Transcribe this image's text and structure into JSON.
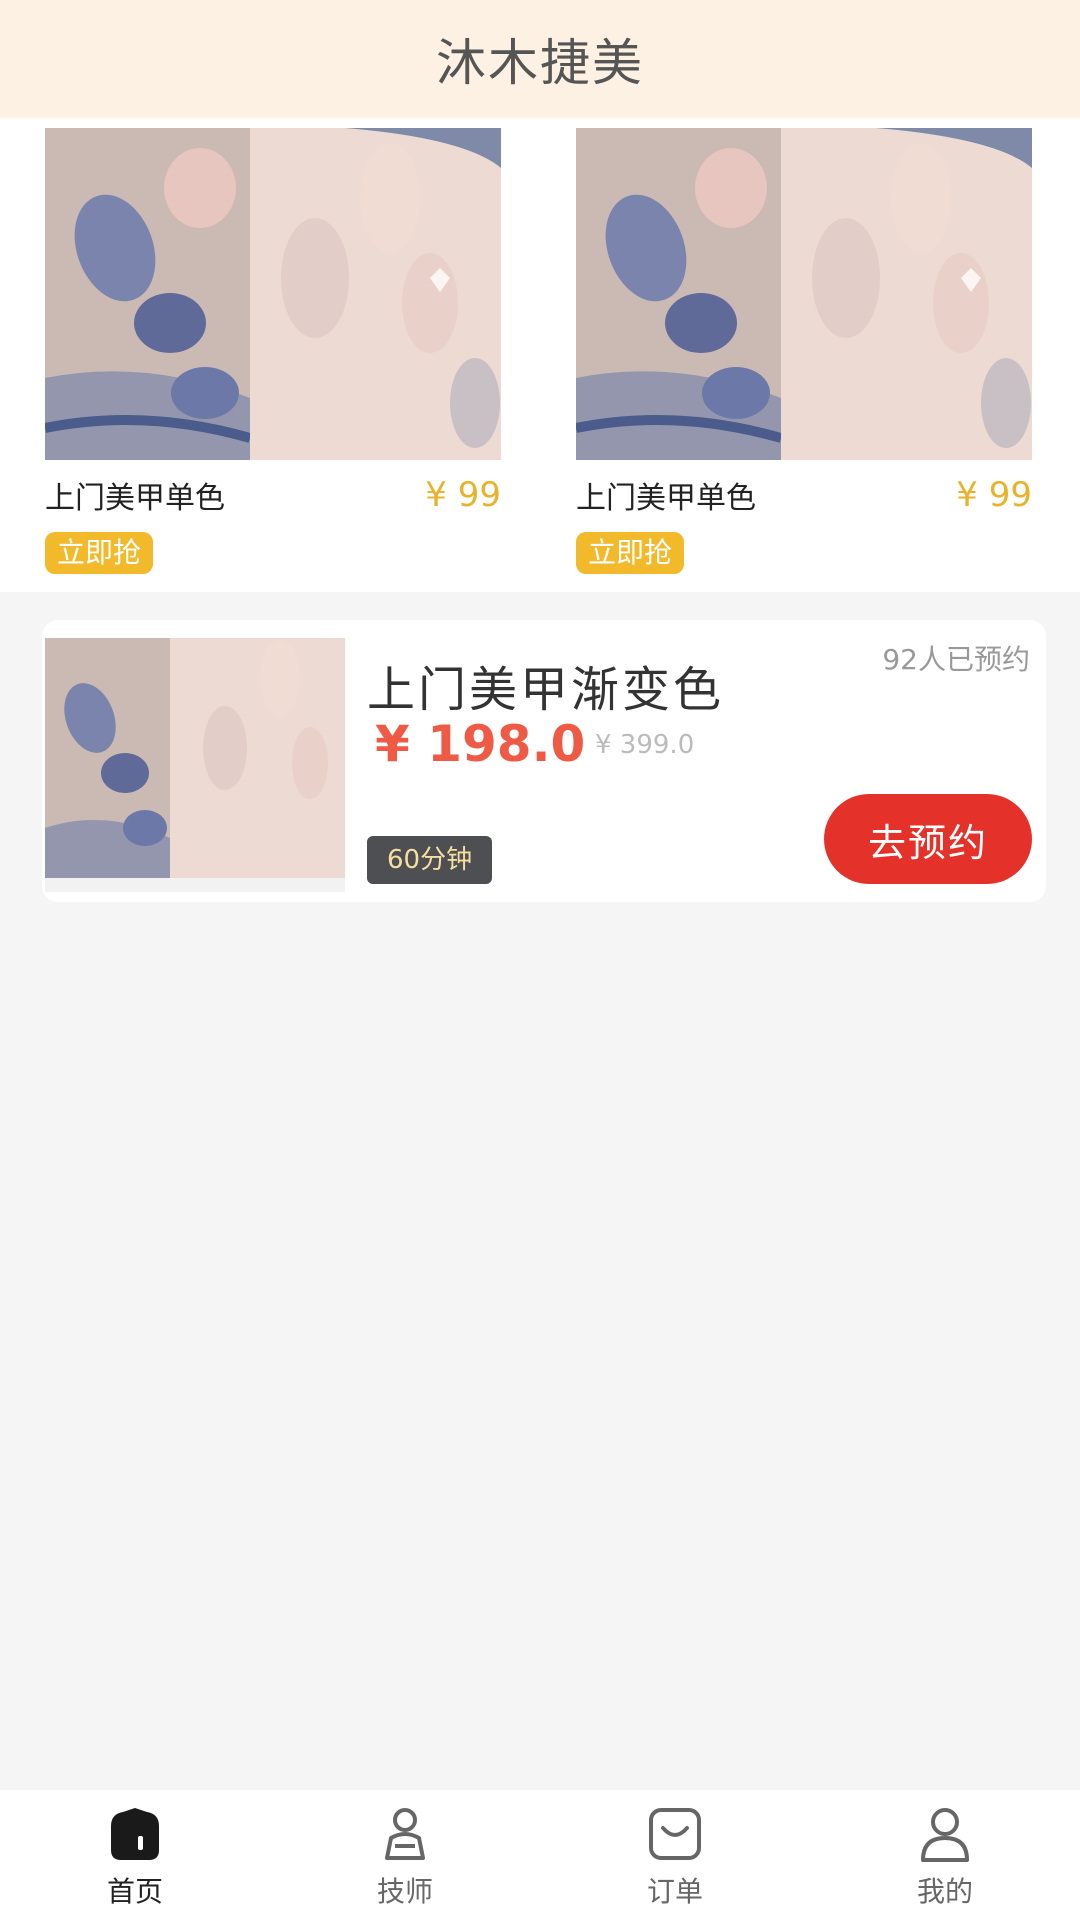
{
  "header": {
    "title": "沐木捷美"
  },
  "flash_sale": [
    {
      "name": "上门美甲单色",
      "price": "¥ 99",
      "button": "立即抢",
      "image_icon": "nail-photo"
    },
    {
      "name": "上门美甲单色",
      "price": "¥ 99",
      "button": "立即抢",
      "image_icon": "nail-photo"
    }
  ],
  "service": {
    "name": "上门美甲渐变色",
    "booked": "92人已预约",
    "price": "¥ 198.0",
    "original_price": "¥ 399.0",
    "duration": "60分钟",
    "book_button": "去预约",
    "image_icon": "nail-photo"
  },
  "tabbar": {
    "items": [
      {
        "label": "首页",
        "icon": "home-icon",
        "active": true
      },
      {
        "label": "技师",
        "icon": "technician-icon",
        "active": false
      },
      {
        "label": "订单",
        "icon": "order-bag-icon",
        "active": false
      },
      {
        "label": "我的",
        "icon": "profile-icon",
        "active": false
      }
    ]
  },
  "colors": {
    "header_bg": "#fdf1e4",
    "accent_yellow": "#f2b92b",
    "price_red": "#ef5a45",
    "button_red": "#e4322b"
  }
}
